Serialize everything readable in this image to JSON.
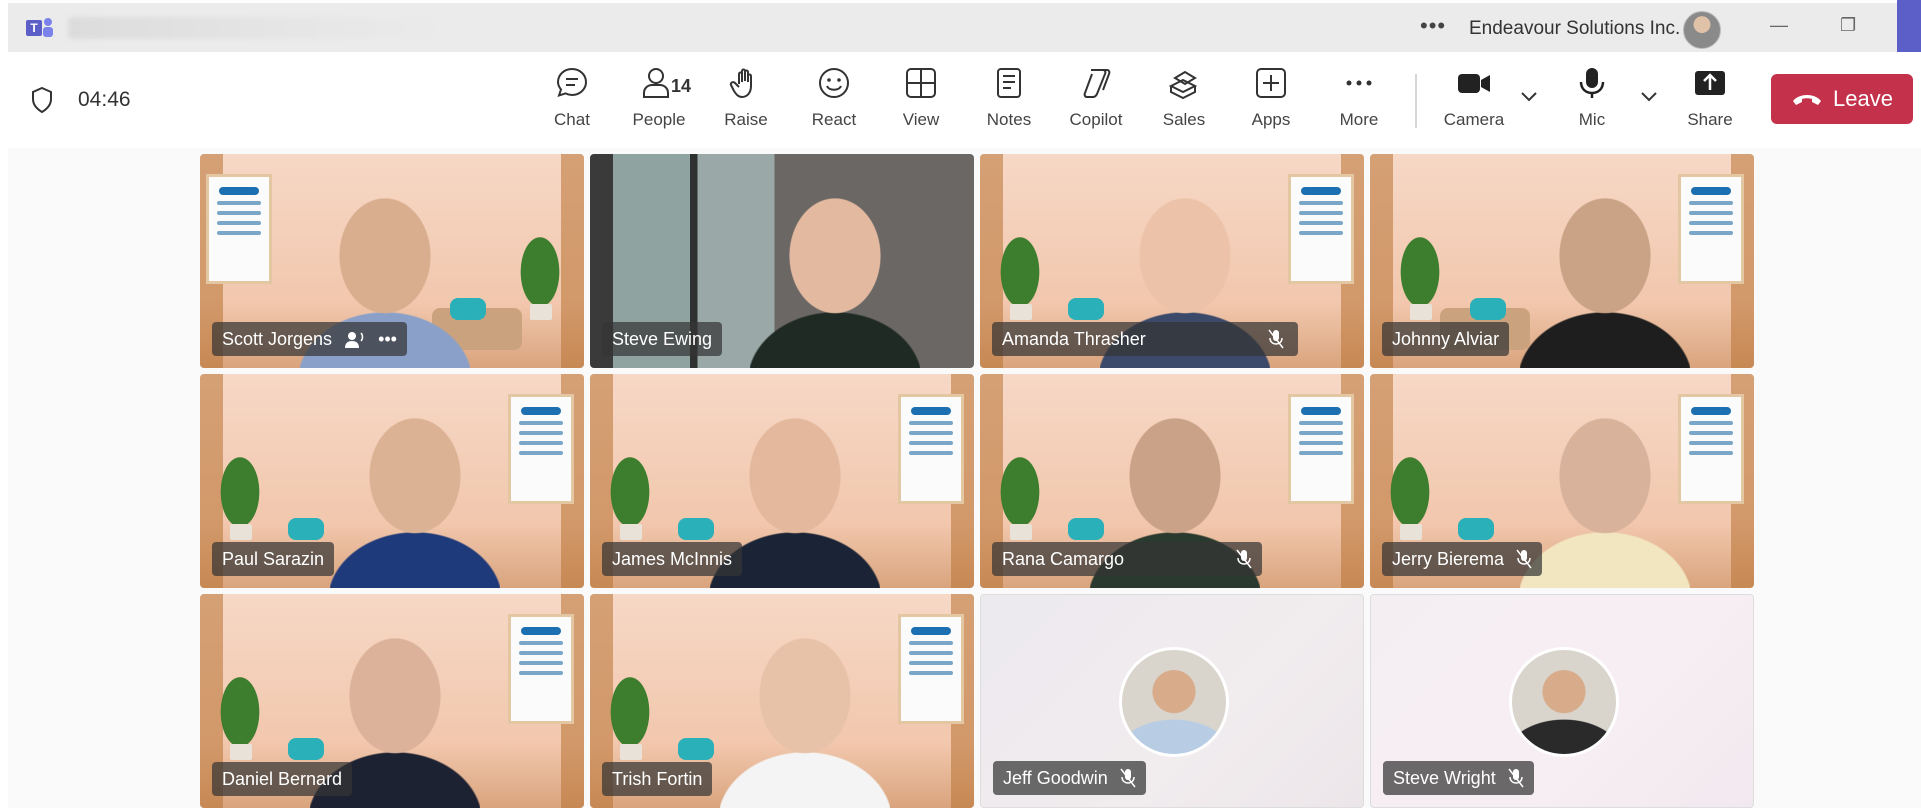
{
  "titlebar": {
    "org": "Endeavour Solutions Inc.",
    "more_icon": "more-horizontal-icon",
    "minimize_glyph": "—",
    "restore_glyph": "❐"
  },
  "callbar": {
    "timer": "04:46",
    "people_count": "14",
    "buttons": {
      "chat": "Chat",
      "people": "People",
      "raise": "Raise",
      "react": "React",
      "view": "View",
      "notes": "Notes",
      "copilot": "Copilot",
      "sales": "Sales",
      "apps": "Apps",
      "more": "More",
      "camera": "Camera",
      "mic": "Mic",
      "share": "Share"
    },
    "leave": "Leave",
    "leave_color": "#c4314b"
  },
  "participants": [
    {
      "name": "Scott Jorgens",
      "speaking": true,
      "muted": false
    },
    {
      "name": "Steve Ewing",
      "muted": false
    },
    {
      "name": "Amanda Thrasher",
      "muted": true
    },
    {
      "name": "Johnny Alviar",
      "muted": false
    },
    {
      "name": "Paul Sarazin",
      "muted": false
    },
    {
      "name": "James McInnis",
      "muted": false
    },
    {
      "name": "Rana Camargo",
      "muted": true
    },
    {
      "name": "Jerry Bierema",
      "muted": true
    },
    {
      "name": "Daniel Bernard",
      "muted": false
    },
    {
      "name": "Trish Fortin",
      "muted": false
    },
    {
      "name": "Jeff Goodwin",
      "muted": true,
      "camera_off": true
    },
    {
      "name": "Steve Wright",
      "muted": true,
      "camera_off": true
    }
  ]
}
